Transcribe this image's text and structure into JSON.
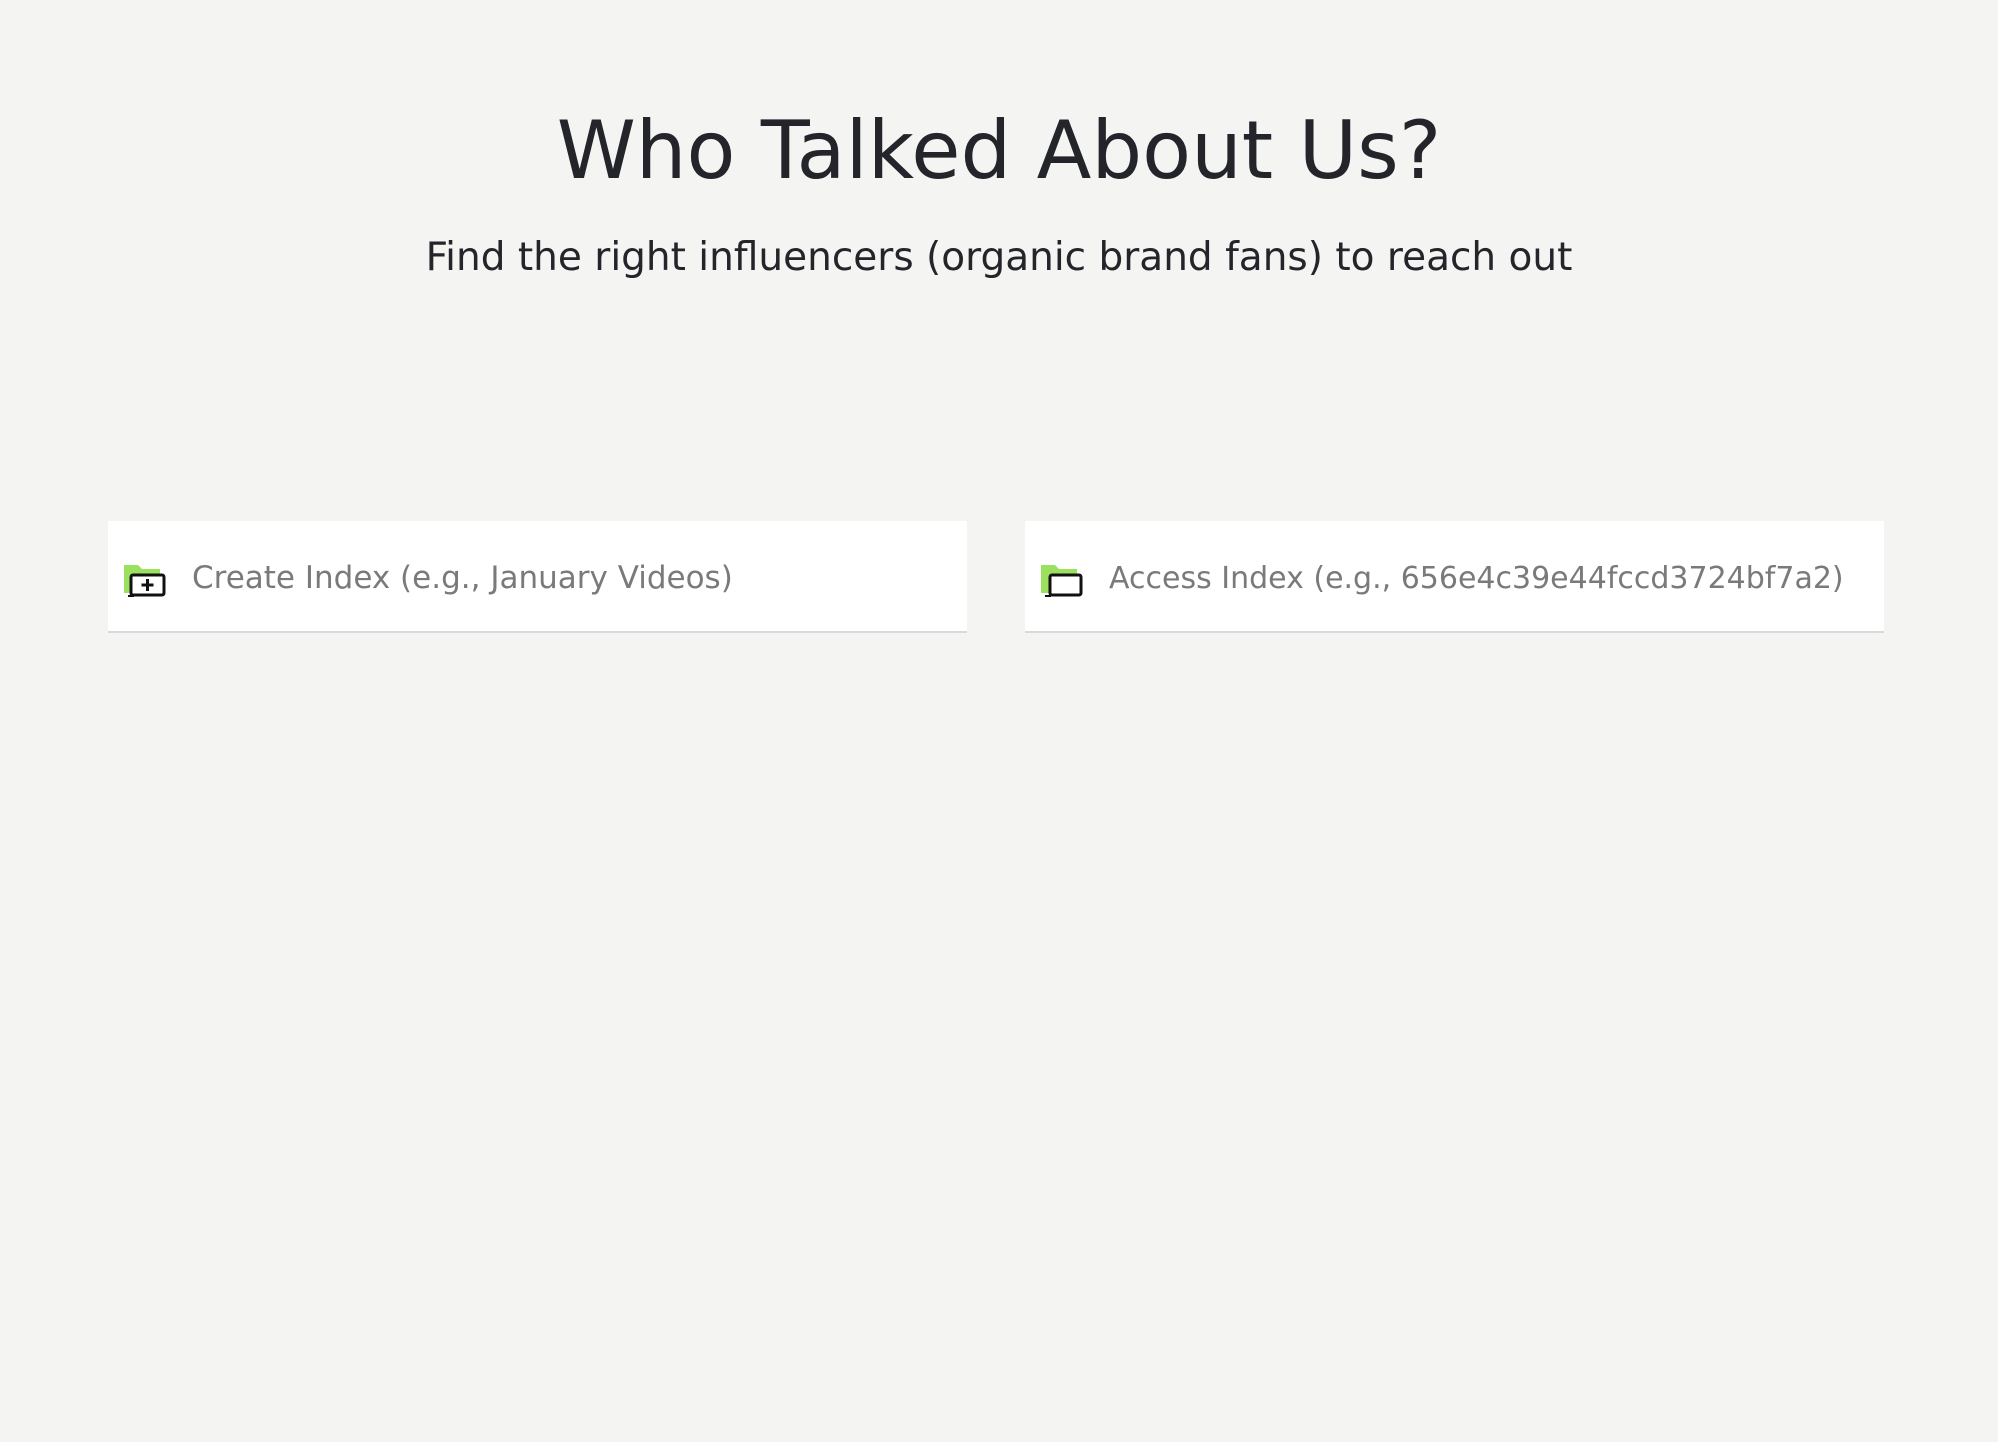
{
  "header": {
    "title": "Who Talked About Us?",
    "subtitle": "Find the right influencers (organic brand fans) to reach out"
  },
  "create_index": {
    "icon": "folder-add-icon",
    "placeholder": "Create Index (e.g., January Videos)",
    "value": ""
  },
  "access_index": {
    "icon": "folder-open-icon",
    "placeholder": "Access Index (e.g., 656e4c39e44fccd3724bf7a2)",
    "value": ""
  },
  "colors": {
    "background": "#f4f4f2",
    "text": "#23252a",
    "placeholder": "#7a7a7a",
    "icon_accent": "#9be05f",
    "field_background": "#ffffff"
  }
}
